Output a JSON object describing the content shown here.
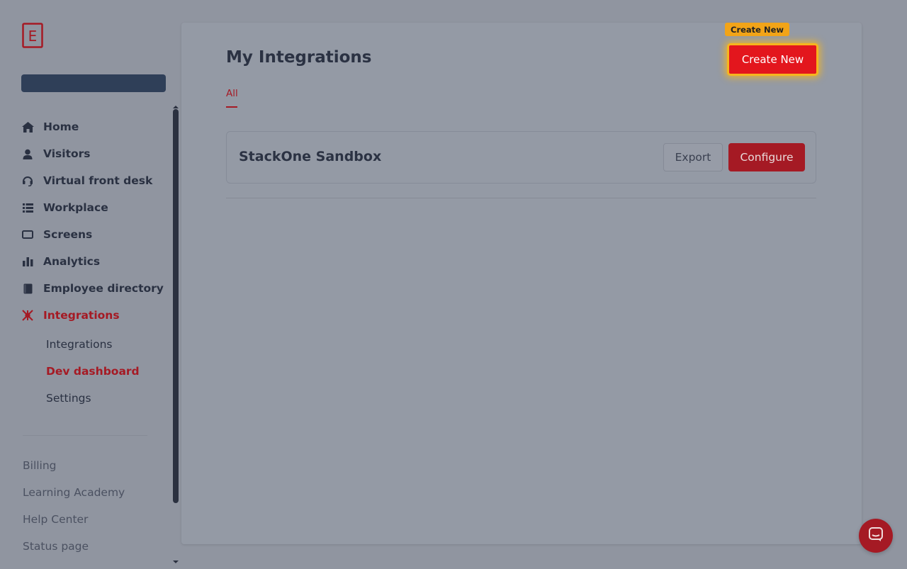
{
  "sidebar": {
    "logo_letter": "E",
    "nav": [
      {
        "label": "Home",
        "icon": "home-icon"
      },
      {
        "label": "Visitors",
        "icon": "user-icon"
      },
      {
        "label": "Virtual front desk",
        "icon": "headset-icon"
      },
      {
        "label": "Workplace",
        "icon": "list-icon"
      },
      {
        "label": "Screens",
        "icon": "monitor-icon"
      },
      {
        "label": "Analytics",
        "icon": "bar-chart-icon"
      },
      {
        "label": "Employee directory",
        "icon": "book-icon"
      },
      {
        "label": "Integrations",
        "icon": "integrations-icon",
        "active": true
      }
    ],
    "sub_nav": [
      {
        "label": "Integrations"
      },
      {
        "label": "Dev dashboard",
        "active": true
      },
      {
        "label": "Settings"
      }
    ],
    "footer": [
      {
        "label": "Billing"
      },
      {
        "label": "Learning Academy"
      },
      {
        "label": "Help Center"
      },
      {
        "label": "Status page"
      }
    ]
  },
  "main": {
    "title": "My Integrations",
    "tabs": [
      {
        "label": "All",
        "active": true
      }
    ],
    "integrations": [
      {
        "name": "StackOne Sandbox",
        "export_label": "Export",
        "configure_label": "Configure"
      }
    ],
    "create_button_label": "Create New",
    "highlight_label": "Create New"
  },
  "colors": {
    "accent": "#a51a24",
    "create_button": "#e3161d",
    "highlight": "#f6b51f",
    "overlay_background": "#9095a0"
  }
}
